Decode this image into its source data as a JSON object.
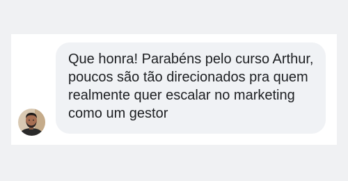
{
  "comment": {
    "author_avatar": "user-avatar",
    "text": "Que honra! Parabéns pelo curso Arthur, poucos são tão direcionados pra quem realmente quer escalar no marketing como um gestor"
  },
  "colors": {
    "page_background": "#f0f1f3",
    "card_background": "#ffffff",
    "bubble_background": "#f0f2f5",
    "text": "#1c1e21"
  }
}
